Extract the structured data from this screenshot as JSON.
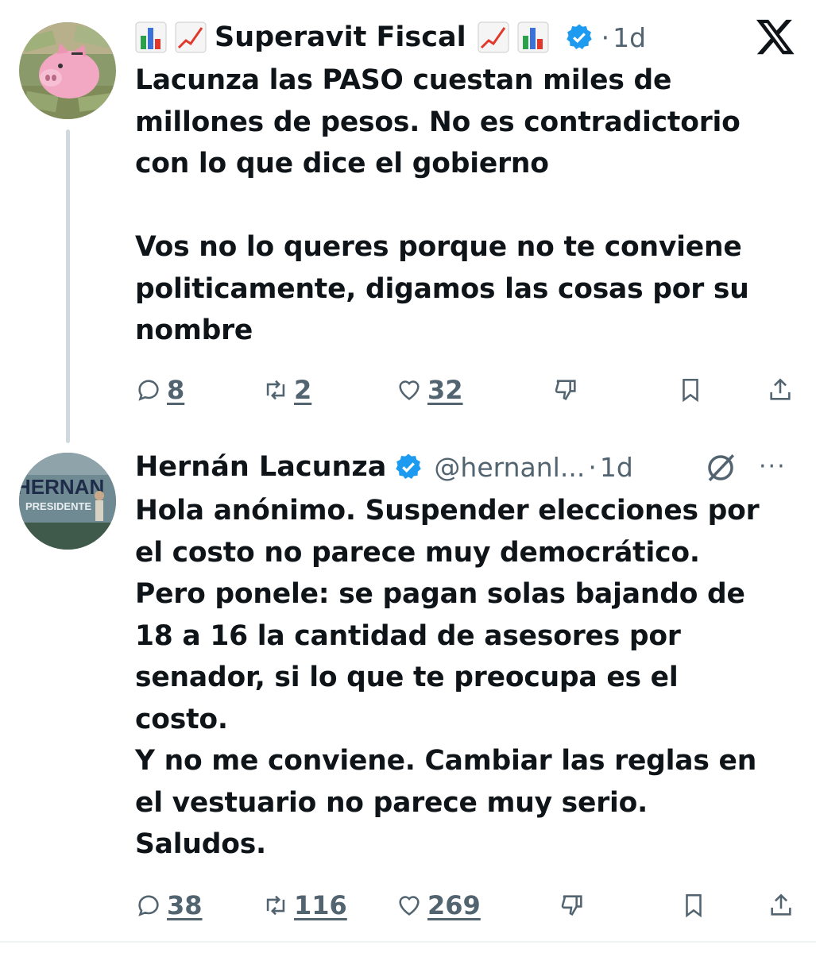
{
  "colors": {
    "verified": "#1d9bf0",
    "muted": "#536471",
    "text": "#0f1419",
    "thread_line": "#cfd9de"
  },
  "tweets": [
    {
      "display_name": "Superavit Fiscal",
      "verified": true,
      "time": "1d",
      "separator": "·",
      "text": "Lacunza las PASO cuestan miles de\nmillones de pesos. No es contradictorio\ncon lo que dice el gobierno\n\nVos no lo queres porque no te conviene\npoliticamente, digamos las cosas por su\nnombre",
      "stats": {
        "replies": "8",
        "reposts": "2",
        "likes": "32"
      },
      "name_emojis": [
        "bar-chart-icon",
        "chart-increasing-icon"
      ]
    },
    {
      "display_name": "Hernán Lacunza",
      "verified": true,
      "handle": "@hernanl...",
      "time": "1d",
      "separator": "·",
      "more": "···",
      "text": "Hola anónimo. Suspender elecciones por\nel costo no parece muy democrático.\nPero ponele: se pagan solas bajando de\n18 a 16 la cantidad de asesores por\nsenador, si lo que te preocupa es el\ncosto.\nY no me conviene. Cambiar las reglas en\nel vestuario no parece muy serio.\nSaludos.",
      "stats": {
        "replies": "38",
        "reposts": "116",
        "likes": "269"
      },
      "avatar_text": {
        "line1": "HERNAN",
        "line2": "PRESIDENTE"
      }
    }
  ]
}
